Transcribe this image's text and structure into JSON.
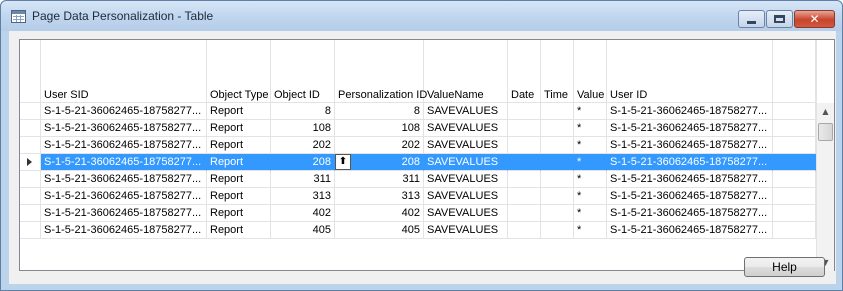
{
  "window": {
    "title": "Page Data Personalization - Table"
  },
  "table": {
    "columns": [
      "User SID",
      "Object Type",
      "Object ID",
      "Personalization ID",
      "ValueName",
      "Date",
      "Time",
      "Value",
      "User ID"
    ],
    "rows": [
      {
        "user_sid": "S-1-5-21-36062465-18758277...",
        "object_type": "Report",
        "object_id": "8",
        "personalization_id": "8",
        "value_name": "SAVEVALUES",
        "date": "",
        "time": "",
        "value": "*",
        "user_id": "S-1-5-21-36062465-18758277..."
      },
      {
        "user_sid": "S-1-5-21-36062465-18758277...",
        "object_type": "Report",
        "object_id": "108",
        "personalization_id": "108",
        "value_name": "SAVEVALUES",
        "date": "",
        "time": "",
        "value": "*",
        "user_id": "S-1-5-21-36062465-18758277..."
      },
      {
        "user_sid": "S-1-5-21-36062465-18758277...",
        "object_type": "Report",
        "object_id": "202",
        "personalization_id": "202",
        "value_name": "SAVEVALUES",
        "date": "",
        "time": "",
        "value": "*",
        "user_id": "S-1-5-21-36062465-18758277..."
      },
      {
        "user_sid": "S-1-5-21-36062465-18758277...",
        "object_type": "Report",
        "object_id": "208",
        "personalization_id": "208",
        "value_name": "SAVEVALUES",
        "date": "",
        "time": "",
        "value": "*",
        "user_id": "S-1-5-21-36062465-18758277..."
      },
      {
        "user_sid": "S-1-5-21-36062465-18758277...",
        "object_type": "Report",
        "object_id": "311",
        "personalization_id": "311",
        "value_name": "SAVEVALUES",
        "date": "",
        "time": "",
        "value": "*",
        "user_id": "S-1-5-21-36062465-18758277..."
      },
      {
        "user_sid": "S-1-5-21-36062465-18758277...",
        "object_type": "Report",
        "object_id": "313",
        "personalization_id": "313",
        "value_name": "SAVEVALUES",
        "date": "",
        "time": "",
        "value": "*",
        "user_id": "S-1-5-21-36062465-18758277..."
      },
      {
        "user_sid": "S-1-5-21-36062465-18758277...",
        "object_type": "Report",
        "object_id": "402",
        "personalization_id": "402",
        "value_name": "SAVEVALUES",
        "date": "",
        "time": "",
        "value": "*",
        "user_id": "S-1-5-21-36062465-18758277..."
      },
      {
        "user_sid": "S-1-5-21-36062465-18758277...",
        "object_type": "Report",
        "object_id": "405",
        "personalization_id": "405",
        "value_name": "SAVEVALUES",
        "date": "",
        "time": "",
        "value": "*",
        "user_id": "S-1-5-21-36062465-18758277..."
      }
    ],
    "selected_row_index": 3
  },
  "buttons": {
    "help_label": "Help"
  },
  "colors": {
    "selection": "#3399ff",
    "window_frame": "#bcd3ec",
    "close_button": "#c7442c"
  },
  "icons": {
    "app": "table-window-icon",
    "minimize": "minimize-icon",
    "maximize": "maximize-icon",
    "close": "close-icon",
    "row_pointer": "row-pointer-icon",
    "lookup": "lookup-arrow-icon",
    "scroll_up": "scroll-up-icon",
    "scroll_down": "scroll-down-icon"
  }
}
